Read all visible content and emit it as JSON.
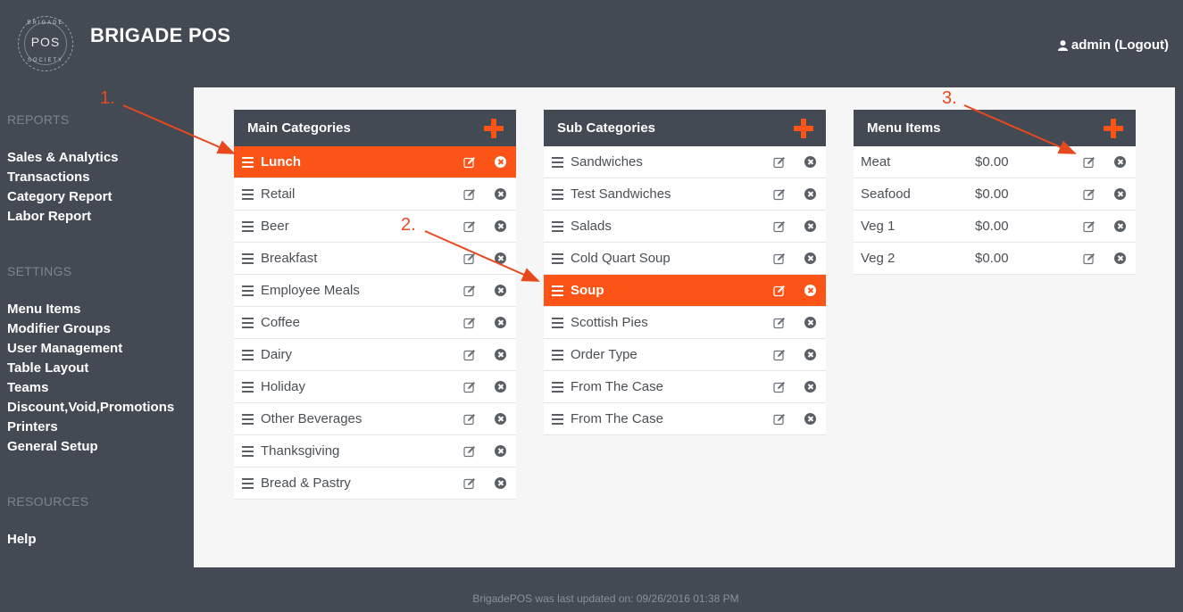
{
  "header": {
    "logo": {
      "top_text": "BRIGADE",
      "center_text": "POS",
      "bottom_text": "SOCIETY"
    },
    "app_title": "BRIGADE POS",
    "user_label": "admin (Logout)"
  },
  "sidebar": {
    "reports_title": "REPORTS",
    "reports": [
      "Sales & Analytics",
      "Transactions",
      "Category Report",
      "Labor Report"
    ],
    "settings_title": "SETTINGS",
    "settings": [
      "Menu Items",
      "Modifier Groups",
      "User Management",
      "Table Layout",
      "Teams",
      "Discount,Void,Promotions",
      "Printers",
      "General Setup"
    ],
    "resources_title": "RESOURCES",
    "resources": [
      "Help"
    ]
  },
  "main_categories": {
    "title": "Main Categories",
    "items": [
      "Lunch",
      "Retail",
      "Beer",
      "Breakfast",
      "Employee Meals",
      "Coffee",
      "Dairy",
      "Holiday",
      "Other Beverages",
      "Thanksgiving",
      "Bread & Pastry"
    ],
    "active": "Lunch"
  },
  "sub_categories": {
    "title": "Sub Categories",
    "items": [
      "Sandwiches",
      "Test Sandwiches",
      "Salads",
      "Cold Quart Soup",
      "Soup",
      "Scottish Pies",
      "Order Type",
      "From The Case",
      "From The Case"
    ],
    "active": "Soup"
  },
  "menu_items": {
    "title": "Menu Items",
    "items": [
      {
        "name": "Meat",
        "price": "$0.00"
      },
      {
        "name": "Seafood",
        "price": "$0.00"
      },
      {
        "name": "Veg 1",
        "price": "$0.00"
      },
      {
        "name": "Veg 2",
        "price": "$0.00"
      }
    ]
  },
  "annotations": [
    "1.",
    "2.",
    "3."
  ],
  "footer": "BrigadePOS was last updated on: 09/26/2016 01:38 PM",
  "colors": {
    "accent": "#fc5316",
    "dark": "#434a54",
    "content_bg": "#f6f6f6",
    "annotation": "#e8481d"
  },
  "icons": [
    "user-icon",
    "plus-icon",
    "drag-handle-icon",
    "edit-icon",
    "delete-icon"
  ]
}
